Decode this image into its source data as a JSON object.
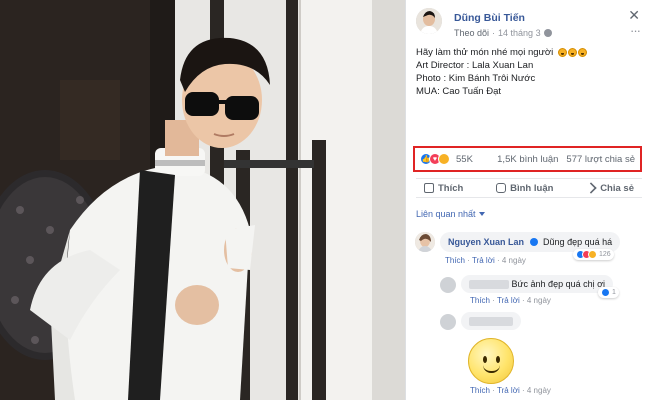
{
  "post": {
    "author": "Dũng Bùi Tiến",
    "follow_label": "Theo dõi",
    "separator": "·",
    "date": "14 tháng 3",
    "close_glyph": "✕",
    "more_glyph": "···",
    "caption_line1": "Hãy làm thử món nhé mọi người",
    "caption_line2": "Art Director : Lala Xuan Lan",
    "caption_line3": "Photo : Kim Bánh Trôi Nước",
    "caption_line4": "MUA: Cao Tuấn Đạt",
    "caption_emojis": [
      "laugh-icon",
      "laugh-icon",
      "laugh-icon"
    ]
  },
  "stats": {
    "reactions_count": "55K",
    "comments_count": "1,5K bình luận",
    "shares_count": "577 lượt chia sẻ",
    "highlight_color": "#e02424"
  },
  "actions": {
    "like_label": "Thích",
    "comment_label": "Bình luận",
    "share_label": "Chia sẻ"
  },
  "sort": {
    "label": "Liên quan nhất"
  },
  "comments": [
    {
      "author": "Nguyen Xuan Lan",
      "text": "Dũng đẹp quá há",
      "like_label": "Thích",
      "reply_label": "Trả lời",
      "time": "4 ngày",
      "reactions": "126"
    },
    {
      "author": "",
      "text": "Bức ảnh đẹp quá chị ơi",
      "like_label": "Thích",
      "reply_label": "Trả lời",
      "time": "4 ngày",
      "reactions": "1"
    },
    {
      "author": "",
      "text": "",
      "like_label": "Thích",
      "reply_label": "Trả lời",
      "time": "4 ngày"
    }
  ],
  "colors": {
    "link_blue": "#385898",
    "action_blue": "#4267b2",
    "bubble_gray": "#f2f3f5"
  }
}
